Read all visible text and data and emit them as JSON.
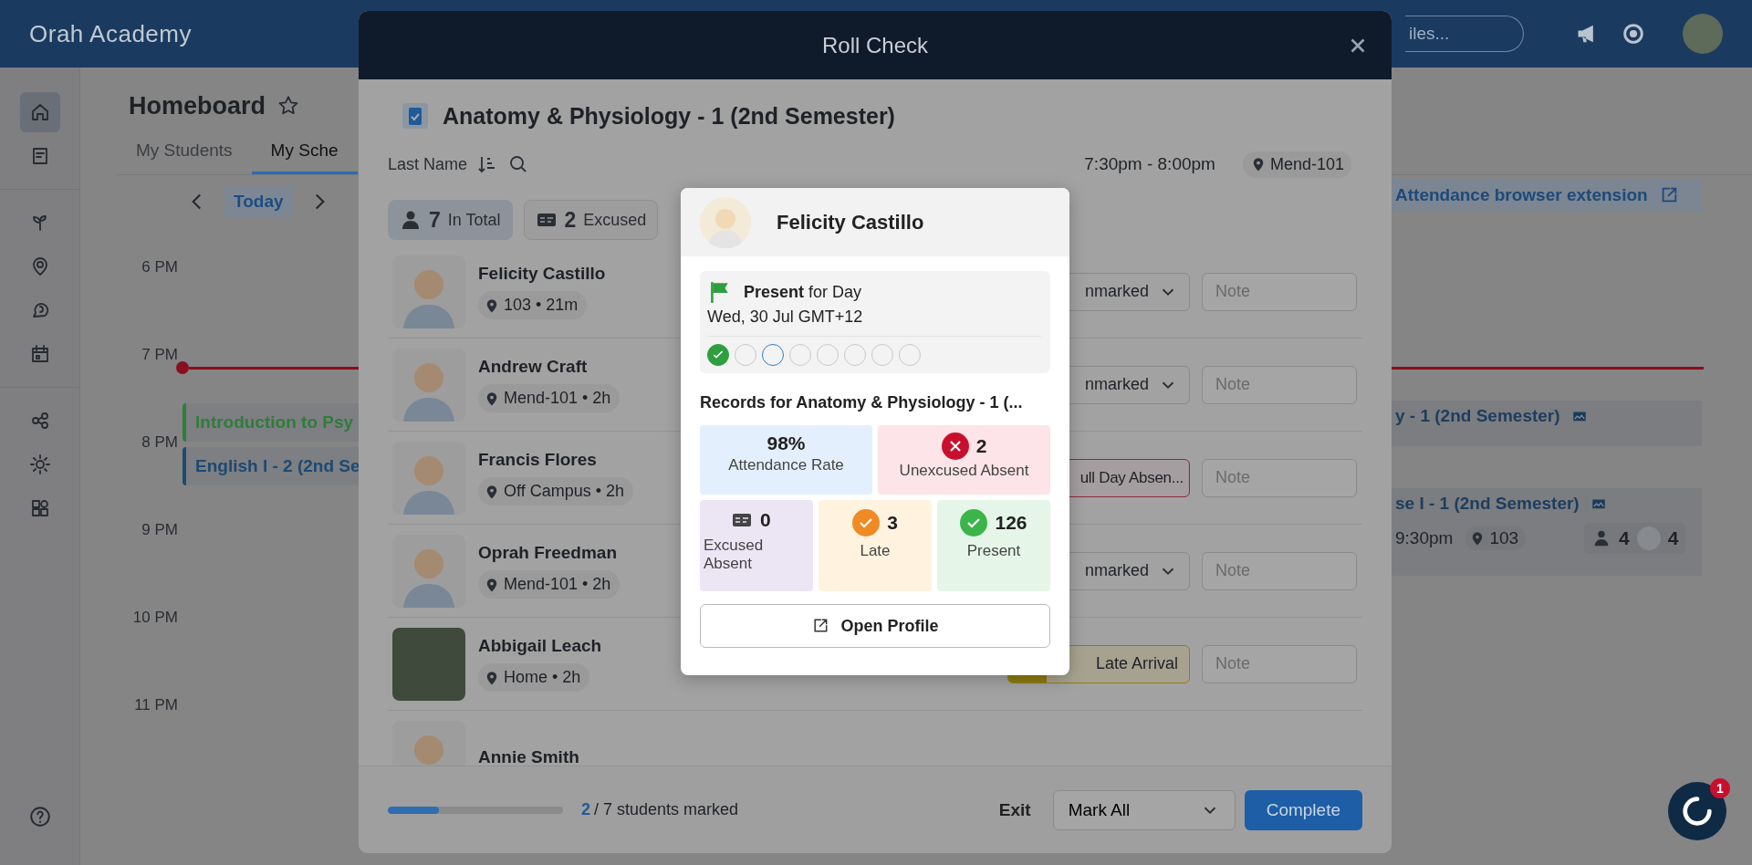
{
  "app": {
    "title": "Orah Academy",
    "search_placeholder": "iles..."
  },
  "sidebar": {
    "items": [
      {
        "selected": true
      },
      {
        "selected": false
      },
      {
        "selected": false
      },
      {
        "selected": false
      },
      {
        "selected": false
      },
      {
        "selected": false
      },
      {
        "selected": false
      },
      {
        "selected": false
      },
      {
        "selected": false
      }
    ]
  },
  "homeboard": {
    "title": "Homeboard",
    "tabs": [
      {
        "label": "My Students",
        "selected": false
      },
      {
        "label": "My Sche",
        "selected": true
      }
    ]
  },
  "calendar": {
    "today": "Today",
    "hours": [
      "6 PM",
      "7 PM",
      "8 PM",
      "9 PM",
      "10 PM",
      "11 PM"
    ],
    "events": [
      {
        "title": "Introduction to Psy",
        "color": "#2f7d3a"
      },
      {
        "title": "English I - 2 (2nd Se",
        "color": "#1d4a72"
      }
    ],
    "extension_link": "Attendance browser extension",
    "right_events": [
      {
        "title": "y - 1 (2nd Semester)"
      },
      {
        "title": "se I - 1 (2nd Semester)",
        "time": "9:30pm",
        "room": "103",
        "students": "4",
        "unmarked": "4"
      }
    ]
  },
  "modal": {
    "title": "Roll Check",
    "class_title": "Anatomy & Physiology - 1 (2nd Semester)",
    "sort_label": "Last Name",
    "time": "7:30pm - 8:00pm",
    "room": "Mend-101",
    "filters": [
      {
        "count": "7",
        "label": "In Total",
        "selected": true
      },
      {
        "count": "2",
        "label": "Excused",
        "selected": false
      }
    ],
    "students": [
      {
        "name": "Felicity Castillo",
        "location": "103 • 21m",
        "avatar": {
          "kind": "illustration"
        },
        "status": {
          "kind": "unmarked",
          "label": "nmarked"
        },
        "note_placeholder": "Note"
      },
      {
        "name": "Andrew Craft",
        "location": "Mend-101 • 2h",
        "avatar": {
          "kind": "illustration"
        },
        "status": {
          "kind": "unmarked",
          "label": "nmarked"
        },
        "note_placeholder": "Note"
      },
      {
        "name": "Francis Flores",
        "location": "Off Campus • 2h",
        "avatar": {
          "kind": "illustration"
        },
        "status": {
          "kind": "absent",
          "label": "ull Day Absen..."
        },
        "note_placeholder": "Note"
      },
      {
        "name": "Oprah Freedman",
        "location": "Mend-101 • 2h",
        "avatar": {
          "kind": "illustration"
        },
        "status": {
          "kind": "unmarked",
          "label": "nmarked"
        },
        "note_placeholder": "Note"
      },
      {
        "name": "Abbigail Leach",
        "location": "Home • 2h",
        "avatar": {
          "kind": "photo"
        },
        "status": {
          "kind": "late",
          "label": "Late Arrival"
        },
        "note_placeholder": "Note"
      },
      {
        "name": "Annie Smith",
        "avatar": {
          "kind": "illustration"
        }
      }
    ],
    "footer": {
      "marked": "2",
      "total": "/ 7 students marked",
      "level": 0.29,
      "exit": "Exit",
      "mark_all": "Mark All",
      "complete": "Complete"
    }
  },
  "popup": {
    "name": "Felicity Castillo",
    "status": "**Present** for Day",
    "date": "Wed, 30 Jul GMT+12",
    "sessions": [
      {
        "checked": true,
        "selected": false
      },
      {
        "checked": false,
        "selected": false
      },
      {
        "checked": false,
        "selected": true
      },
      {
        "checked": false,
        "selected": false
      },
      {
        "checked": false,
        "selected": false
      },
      {
        "checked": false,
        "selected": false
      },
      {
        "checked": false,
        "selected": false
      },
      {
        "checked": false,
        "selected": false
      }
    ],
    "records_title": "Records for Anatomy & Physiology - 1 (...",
    "stats": [
      {
        "kind": "rate",
        "value": "98%",
        "label": "Attendance Rate"
      },
      {
        "kind": "unexcused",
        "value": "2",
        "label": "Unexcused Absent"
      },
      {
        "kind": "excused",
        "value": "0",
        "label": "Excused Absent"
      },
      {
        "kind": "late",
        "value": "3",
        "label": "Late"
      },
      {
        "kind": "present",
        "value": "126",
        "label": "Present"
      }
    ],
    "open_profile": "Open Profile"
  },
  "chat": {
    "badge": "1"
  }
}
